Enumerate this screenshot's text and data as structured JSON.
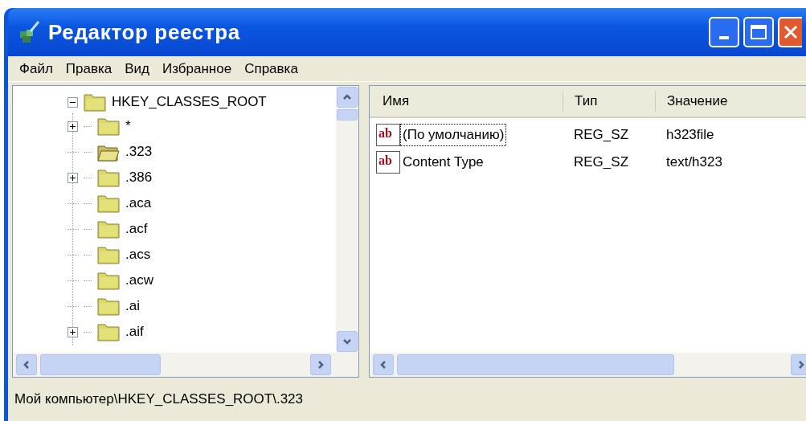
{
  "window": {
    "title": "Редактор реестра"
  },
  "menu": [
    "Файл",
    "Правка",
    "Вид",
    "Избранное",
    "Справка"
  ],
  "tree": {
    "label": "HKEY_CLASSES_ROOT",
    "expanded": true,
    "children": [
      {
        "label": "*",
        "expandable": true,
        "selected": false
      },
      {
        "label": ".323",
        "expandable": false,
        "selected": true
      },
      {
        "label": ".386",
        "expandable": true,
        "selected": false
      },
      {
        "label": ".aca",
        "expandable": false,
        "selected": false
      },
      {
        "label": ".acf",
        "expandable": false,
        "selected": false
      },
      {
        "label": ".acs",
        "expandable": false,
        "selected": false
      },
      {
        "label": ".acw",
        "expandable": false,
        "selected": false
      },
      {
        "label": ".ai",
        "expandable": false,
        "selected": false
      },
      {
        "label": ".aif",
        "expandable": true,
        "selected": false
      }
    ]
  },
  "list": {
    "columns": [
      "Имя",
      "Тип",
      "Значение"
    ],
    "rows": [
      {
        "icon": "ab",
        "name": "(По умолчанию)",
        "type": "REG_SZ",
        "value": "h323file",
        "focused": true
      },
      {
        "icon": "ab",
        "name": "Content Type",
        "type": "REG_SZ",
        "value": "text/h323",
        "focused": false
      }
    ]
  },
  "status_bar": "Мой компьютер\\HKEY_CLASSES_ROOT\\.323"
}
